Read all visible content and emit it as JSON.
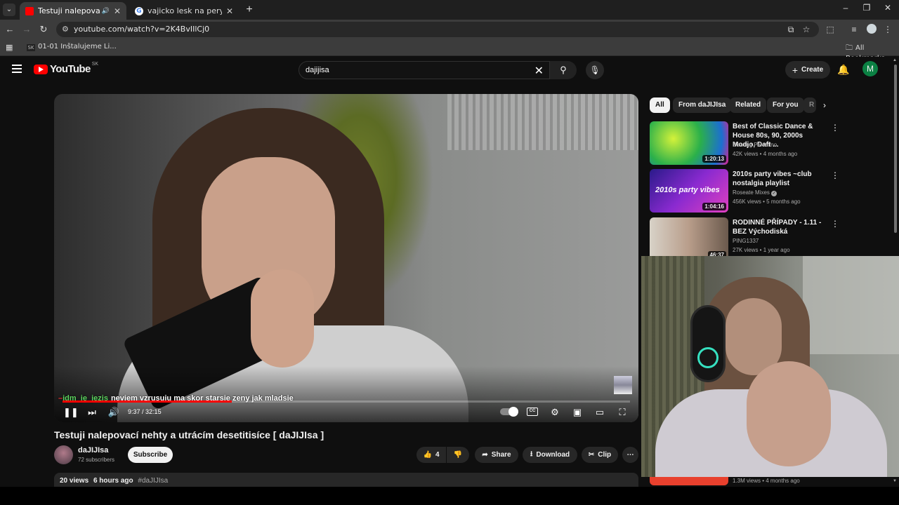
{
  "browser": {
    "tabs": [
      {
        "title": "Testuji nalepovací nehty a u",
        "active": true,
        "favicon_color": "#ff0000"
      },
      {
        "title": "vajicko lesk na pery - Google S",
        "active": false,
        "favicon_color": "#4285f4"
      }
    ],
    "new_tab": "+",
    "url": "youtube.com/watch?v=2K4BvIIlCj0",
    "bookmarks": [
      {
        "label": "01-01 Inštalujeme Li...",
        "icon": "SK"
      }
    ],
    "all_bookmarks": "All Bookmarks"
  },
  "youtube": {
    "logo_text": "YouTube",
    "country_code": "SK",
    "search_query": "dajijisa",
    "create_label": "Create",
    "account_initial": "M"
  },
  "player": {
    "chat_user": "jdm_je_jezis",
    "chat_message": "neviem vzrusuju ma skor starsie zeny jak mladsie",
    "time_current": "9:37",
    "time_total": "32:15",
    "progress_fraction": 0.298,
    "cc_label": "CC"
  },
  "video": {
    "title": "Testuji nalepovací nehty a utrácím desetitisíce [ daJIJIsa ]",
    "channel": "daJIJIsa",
    "subscribers": "72 subscribers",
    "subscribe_label": "Subscribe",
    "likes": "4",
    "share_label": "Share",
    "download_label": "Download",
    "clip_label": "Clip",
    "views": "20 views",
    "age": "6 hours ago",
    "hashtag": "#daJIJIsa"
  },
  "chips": [
    "All",
    "From daJIJIsa",
    "Related",
    "For you",
    "R"
  ],
  "recommendations": [
    {
      "title": "Best of Classic Dance & House 80s, 90, 2000s Modjo, Daft ...",
      "channel": "Bowling Palestino",
      "meta": "42K views • 4 months ago",
      "duration": "1:20:13"
    },
    {
      "title": "2010s party vibes ~club nostalgia playlist",
      "channel": "Roseate Mixes",
      "meta": "456K views • 5 months ago",
      "duration": "1:04:16",
      "thumb_text": "2010s party vibes"
    },
    {
      "title": "RODINNÉ PŘÍPADY - 1.11 - BEZ Východiská",
      "channel": "PING1337",
      "meta": "27K views • 1 year ago",
      "duration": "46:37"
    }
  ],
  "bottom_rec_meta": "1.3M views • 4 months ago"
}
